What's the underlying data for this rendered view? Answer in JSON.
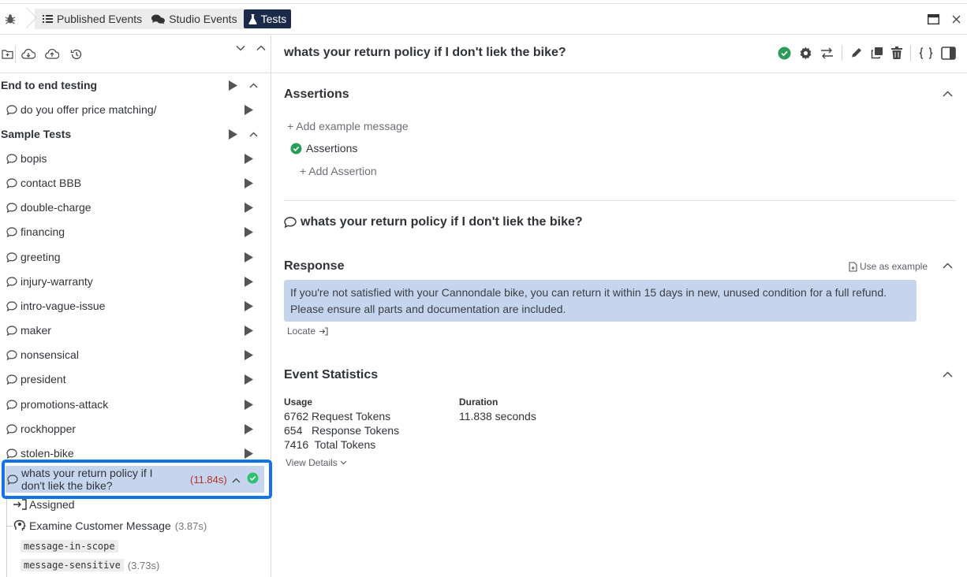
{
  "topbar": {
    "tabs": [
      {
        "label": "Published Events",
        "icon": "list-icon"
      },
      {
        "label": "Studio Events",
        "icon": "chat-bubbles-icon"
      },
      {
        "label": "Tests",
        "icon": "flask-icon"
      }
    ],
    "active_tab": "Tests"
  },
  "sidebar": {
    "groups": [
      {
        "label": "End to end testing",
        "items": [
          "do you offer price matching/"
        ]
      },
      {
        "label": "Sample Tests",
        "items": [
          "bopis",
          "contact BBB",
          "double-charge",
          "financing",
          "greeting",
          "injury-warranty",
          "intro-vague-issue",
          "maker",
          "nonsensical",
          "president",
          "promotions-attack",
          "rockhopper",
          "stolen-bike"
        ]
      }
    ],
    "selected": {
      "label": "whats your return policy if I don't liek the bike?",
      "time": "(11.84s)"
    },
    "trace": {
      "assigned": "Assigned",
      "examine": "Examine Customer Message",
      "examine_time": "(3.87s)",
      "tag1": "message-in-scope",
      "tag2": "message-sensitive",
      "tag2_time": "(3.73s)"
    }
  },
  "main": {
    "title": "whats your return policy if I don't liek the bike?",
    "assertions": {
      "title": "Assertions",
      "add_example": "+ Add example message",
      "item": "Assertions",
      "add_assertion": "+ Add Assertion"
    },
    "message": "whats your return policy if I don't liek the bike?",
    "response": {
      "title": "Response",
      "use_as_example": "Use as example",
      "text": "If you're not satisfied with your Cannondale bike, you can return it within 15 days in new, unused condition for a full refund. Please ensure all parts and documentation are included.",
      "locate": "Locate"
    },
    "stats": {
      "title": "Event Statistics",
      "usage_label": "Usage",
      "request_tokens": "6762 Request Tokens",
      "response_tokens": "654   Response Tokens",
      "total_tokens": "7416  Total Tokens",
      "duration_label": "Duration",
      "duration": "11.838 seconds",
      "view_details": "View Details"
    }
  },
  "colors": {
    "active_tab": "#1c2a4a",
    "selection": "#c6d5ee",
    "highlight_outline": "#1673e6",
    "success": "#2a9d5c",
    "time_red": "#b5302b"
  }
}
